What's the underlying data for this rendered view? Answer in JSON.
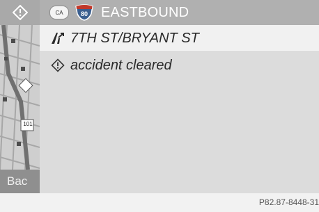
{
  "header": {
    "state_abbr": "CA",
    "route_number": "80",
    "direction": "EASTBOUND"
  },
  "map": {
    "route_sign": "101",
    "back_label": "Bac"
  },
  "messages": [
    {
      "text": "7TH ST/BRYANT ST",
      "icon": "road-junction-icon"
    },
    {
      "text": "accident cleared",
      "icon": "warning-diamond-icon"
    }
  ],
  "footer": {
    "reference": "P82.87-8448-31"
  },
  "colors": {
    "header_bg": "#b0b0b0",
    "selected_row": "#f1f1f1",
    "list_bg": "#dcdcdc",
    "shield_blue": "#3b5f8f",
    "shield_red": "#c0392b"
  }
}
